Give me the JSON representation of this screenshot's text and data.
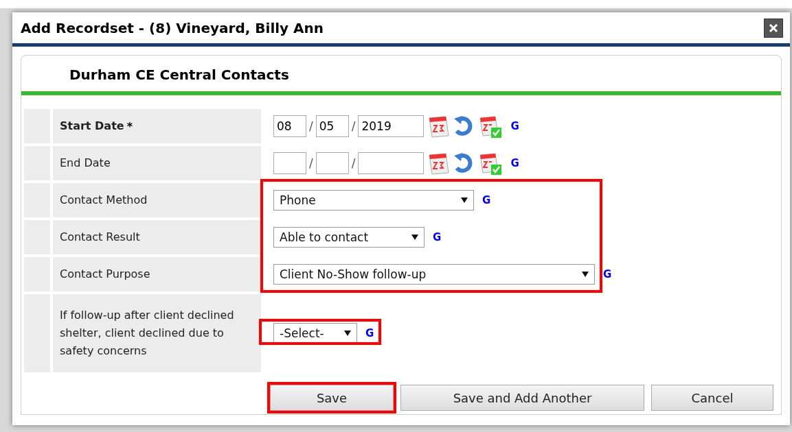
{
  "window": {
    "title": "Add Recordset - (8) Vineyard, Billy Ann"
  },
  "form": {
    "heading": "Durham CE Central Contacts",
    "groups": [
      {
        "highlighted": false,
        "fields": [
          {
            "kind": "date",
            "label": "Start Date",
            "required_mark": "*",
            "month": "08",
            "day": "05",
            "year": "2019",
            "separator": "/",
            "link": "G"
          },
          {
            "kind": "date",
            "label": "End Date",
            "separator": "/",
            "link": "G"
          }
        ]
      },
      {
        "highlighted": true,
        "fields": [
          {
            "kind": "select",
            "label": "Contact Method",
            "value": "Phone",
            "link": "G"
          },
          {
            "kind": "select",
            "label": "Contact Result",
            "value": "Able to contact",
            "link": "G"
          },
          {
            "kind": "select",
            "label": "Contact Purpose",
            "value": "Client No-Show follow-up",
            "link": "G"
          }
        ]
      },
      {
        "highlighted": true,
        "fields": [
          {
            "kind": "select",
            "label": "If follow-up after client declined shelter, client declined due to safety concerns",
            "value": "-Select-",
            "link": "G"
          }
        ]
      }
    ],
    "buttons": [
      {
        "label": "Save",
        "highlighted": true
      },
      {
        "label": "Save and Add Another",
        "highlighted": false
      },
      {
        "label": "Cancel",
        "highlighted": false
      }
    ]
  }
}
